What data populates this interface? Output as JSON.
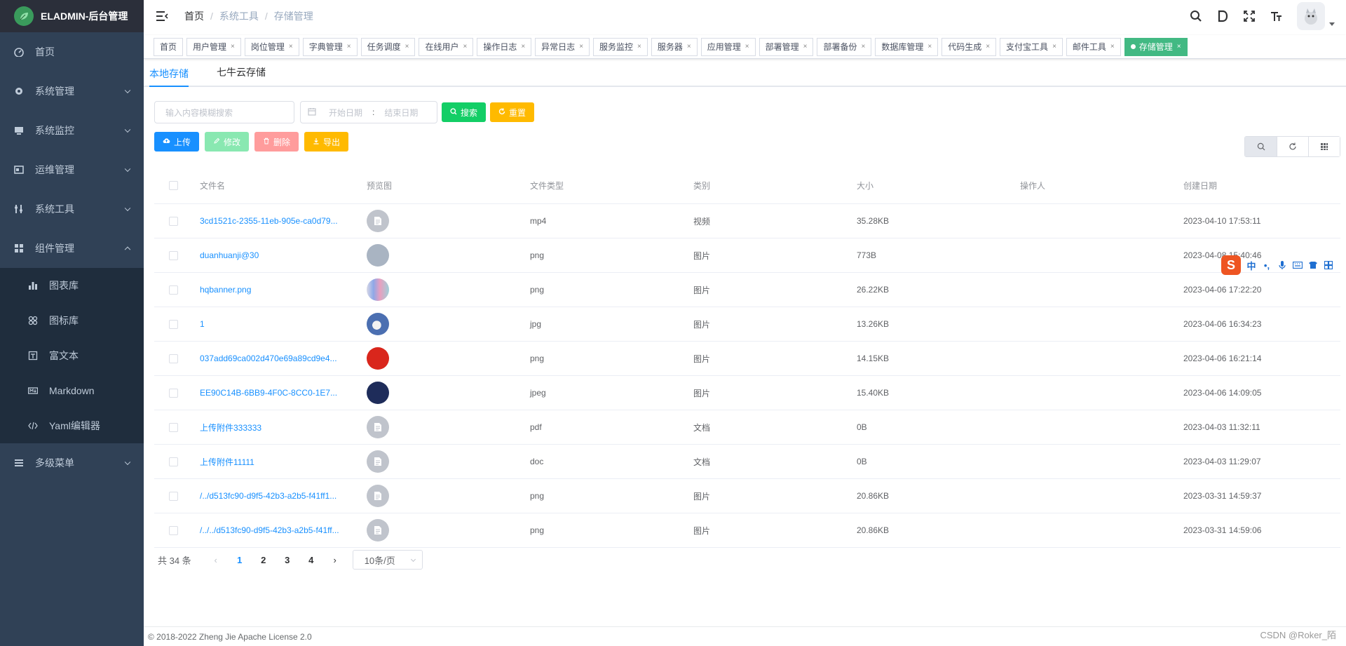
{
  "app": {
    "title": "ELADMIN-后台管理"
  },
  "sidebar": {
    "items": [
      {
        "label": "首页",
        "icon": "dashboard-icon"
      },
      {
        "label": "系统管理",
        "icon": "gear-icon"
      },
      {
        "label": "系统监控",
        "icon": "monitor-icon"
      },
      {
        "label": "运维管理",
        "icon": "server-icon"
      },
      {
        "label": "系统工具",
        "icon": "tools-icon"
      },
      {
        "label": "组件管理",
        "icon": "grid-icon"
      }
    ],
    "sub_items": [
      {
        "label": "图表库",
        "icon": "chart-icon"
      },
      {
        "label": "图标库",
        "icon": "icons-icon"
      },
      {
        "label": "富文本",
        "icon": "richtext-icon"
      },
      {
        "label": "Markdown",
        "icon": "markdown-icon"
      },
      {
        "label": "Yaml编辑器",
        "icon": "code-icon"
      }
    ],
    "last_item": {
      "label": "多级菜单",
      "icon": "list-icon"
    }
  },
  "breadcrumb": [
    "首页",
    "系统工具",
    "存储管理"
  ],
  "tags": [
    {
      "label": "首页",
      "closable": false
    },
    {
      "label": "用户管理",
      "closable": true
    },
    {
      "label": "岗位管理",
      "closable": true
    },
    {
      "label": "字典管理",
      "closable": true
    },
    {
      "label": "任务调度",
      "closable": true
    },
    {
      "label": "在线用户",
      "closable": true
    },
    {
      "label": "操作日志",
      "closable": true
    },
    {
      "label": "异常日志",
      "closable": true
    },
    {
      "label": "服务监控",
      "closable": true
    },
    {
      "label": "服务器",
      "closable": true
    },
    {
      "label": "应用管理",
      "closable": true
    },
    {
      "label": "部署管理",
      "closable": true
    },
    {
      "label": "部署备份",
      "closable": true
    },
    {
      "label": "数据库管理",
      "closable": true
    },
    {
      "label": "代码生成",
      "closable": true
    },
    {
      "label": "支付宝工具",
      "closable": true
    },
    {
      "label": "邮件工具",
      "closable": true
    }
  ],
  "active_tag": "存储管理",
  "tabs": [
    "本地存储",
    "七牛云存储"
  ],
  "filters": {
    "search_placeholder": "输入内容模糊搜索",
    "start_placeholder": "开始日期",
    "range_sep": ":",
    "end_placeholder": "结束日期",
    "search_btn": "搜索",
    "reset_btn": "重置"
  },
  "ops": {
    "upload": "上传",
    "edit": "修改",
    "delete": "删除",
    "export": "导出"
  },
  "table": {
    "headers": [
      "文件名",
      "预览图",
      "文件类型",
      "类别",
      "大小",
      "操作人",
      "创建日期"
    ],
    "rows": [
      {
        "name": "3cd1521c-2355-11eb-905e-ca0d79...",
        "type": "mp4",
        "category": "视频",
        "size": "35.28KB",
        "operator": "",
        "date": "2023-04-10 17:53:11",
        "thumb": "doc"
      },
      {
        "name": "duanhuanji@30",
        "type": "png",
        "category": "图片",
        "size": "773B",
        "operator": "",
        "date": "2023-04-08 15:40:46",
        "thumb": "png1"
      },
      {
        "name": "hqbanner.png",
        "type": "png",
        "category": "图片",
        "size": "26.22KB",
        "operator": "",
        "date": "2023-04-06 17:22:20",
        "thumb": "banner"
      },
      {
        "name": "1",
        "type": "jpg",
        "category": "图片",
        "size": "13.26KB",
        "operator": "",
        "date": "2023-04-06 16:34:23",
        "thumb": "jpg"
      },
      {
        "name": "037add69ca002d470e69a89cd9e4...",
        "type": "png",
        "category": "图片",
        "size": "14.15KB",
        "operator": "",
        "date": "2023-04-06 16:21:14",
        "thumb": "red"
      },
      {
        "name": "EE90C14B-6BB9-4F0C-8CC0-1E7...",
        "type": "jpeg",
        "category": "图片",
        "size": "15.40KB",
        "operator": "",
        "date": "2023-04-06 14:09:05",
        "thumb": "phone"
      },
      {
        "name": "上传附件333333",
        "type": "pdf",
        "category": "文档",
        "size": "0B",
        "operator": "",
        "date": "2023-04-03 11:32:11",
        "thumb": "doc"
      },
      {
        "name": "上传附件11111",
        "type": "doc",
        "category": "文档",
        "size": "0B",
        "operator": "",
        "date": "2023-04-03 11:29:07",
        "thumb": "doc"
      },
      {
        "name": "/../d513fc90-d9f5-42b3-a2b5-f41ff1...",
        "type": "png",
        "category": "图片",
        "size": "20.86KB",
        "operator": "",
        "date": "2023-03-31 14:59:37",
        "thumb": "doc"
      },
      {
        "name": "/../../d513fc90-d9f5-42b3-a2b5-f41ff...",
        "type": "png",
        "category": "图片",
        "size": "20.86KB",
        "operator": "",
        "date": "2023-03-31 14:59:06",
        "thumb": "doc"
      }
    ]
  },
  "pagination": {
    "total": "共 34 条",
    "pages": [
      "1",
      "2",
      "3",
      "4"
    ],
    "active": "1",
    "size": "10条/页"
  },
  "footer": {
    "text": "© 2018-2022 Zheng Jie Apache License 2.0",
    "watermark": "CSDN @Roker_陌"
  },
  "ime": {
    "logo": "S",
    "lang": "中"
  },
  "colors": {
    "sidebar": "#304156",
    "primary": "#1890ff",
    "success": "#13ce66",
    "warning": "#ffba00",
    "danger": "#ff4949",
    "active_tag": "#42b983"
  }
}
